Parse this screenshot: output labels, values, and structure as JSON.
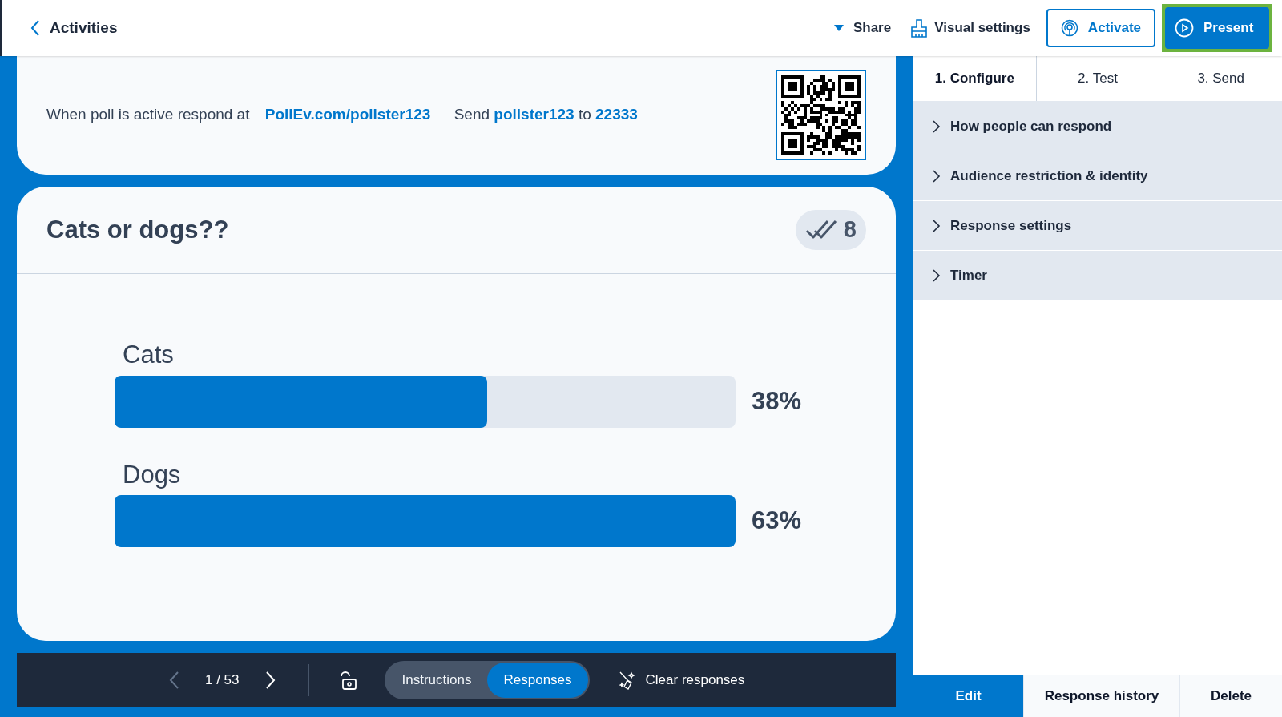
{
  "header": {
    "back_label": "Activities",
    "share": "Share",
    "visual_settings": "Visual settings",
    "activate": "Activate",
    "present": "Present"
  },
  "instructions": {
    "text": "When poll is active respond at",
    "url": "PollEv.com/pollster123",
    "send_prefix": "Send",
    "keyword": "pollster123",
    "to": "to",
    "number": "22333"
  },
  "poll": {
    "title": "Cats or dogs??",
    "response_count": "8",
    "options": [
      {
        "label": "Cats",
        "level": 0.6,
        "percent": "38%"
      },
      {
        "label": "Dogs",
        "level": 1.0,
        "percent": "63%"
      }
    ]
  },
  "toolbar": {
    "page": "1 / 53",
    "tabs": [
      {
        "label": "Instructions",
        "selected": false
      },
      {
        "label": "Responses",
        "selected": true
      }
    ],
    "clear": "Clear responses"
  },
  "steps": [
    {
      "label": "1. Configure",
      "selected": true
    },
    {
      "label": "2. Test",
      "selected": false
    },
    {
      "label": "3. Send",
      "selected": false
    }
  ],
  "sections": [
    {
      "label": "How people can respond",
      "expanded": false
    },
    {
      "label": "Audience restriction & identity",
      "expanded": false
    },
    {
      "label": "Response settings",
      "expanded": false
    },
    {
      "label": "Timer",
      "expanded": false
    }
  ],
  "bottom_tabs": [
    {
      "label": "Edit",
      "selected": true
    },
    {
      "label": "Response history",
      "selected": false
    },
    {
      "label": "Delete",
      "selected": false
    }
  ]
}
